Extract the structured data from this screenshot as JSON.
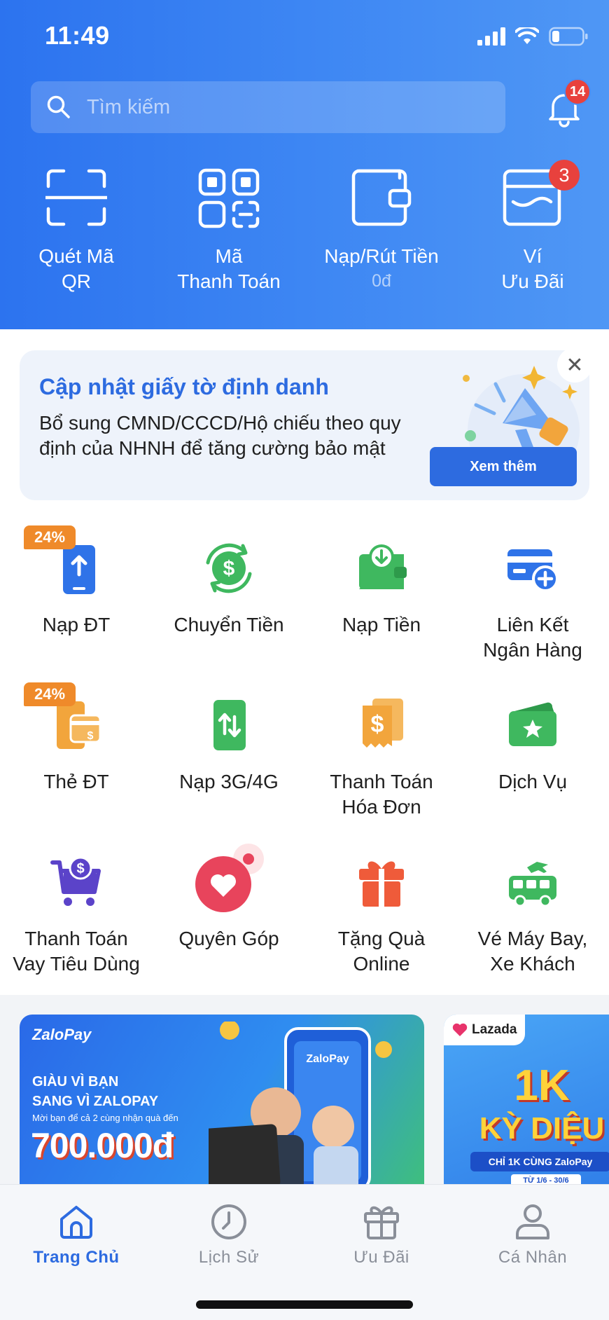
{
  "status_bar": {
    "time": "11:49"
  },
  "search": {
    "placeholder": "Tìm kiếm"
  },
  "notifications": {
    "badge": "14"
  },
  "quick_actions": [
    {
      "label_line1": "Quét Mã",
      "label_line2": "QR",
      "icon": "qr-scan-icon"
    },
    {
      "label_line1": "Mã",
      "label_line2": "Thanh Toán",
      "icon": "payment-code-icon"
    },
    {
      "label_line1": "Nạp/Rút Tiền",
      "sub": "0đ",
      "icon": "wallet-icon"
    },
    {
      "label_line1": "Ví",
      "label_line2": "Ưu Đãi",
      "badge": "3",
      "icon": "voucher-wallet-icon"
    }
  ],
  "promo": {
    "title": "Cập nhật giấy tờ định danh",
    "text": "Bổ sung CMND/CCCD/Hộ chiếu theo quy định của NHNH để tăng cường bảo mật",
    "button": "Xem thêm",
    "close": "✕"
  },
  "services": [
    {
      "label_line1": "Nạp ĐT",
      "badge": "24%",
      "icon": "phone-topup-icon",
      "color": "#2f73e8"
    },
    {
      "label_line1": "Chuyển Tiền",
      "icon": "money-transfer-icon",
      "color": "#3fb85f"
    },
    {
      "label_line1": "Nạp Tiền",
      "icon": "deposit-icon",
      "color": "#3fb85f"
    },
    {
      "label_line1": "Liên Kết",
      "label_line2": "Ngân Hàng",
      "icon": "bank-link-icon",
      "color": "#2f73e8"
    },
    {
      "label_line1": "Thẻ ĐT",
      "badge": "24%",
      "icon": "phone-card-icon",
      "color": "#f2a53c"
    },
    {
      "label_line1": "Nạp 3G/4G",
      "icon": "mobile-data-icon",
      "color": "#3fb85f"
    },
    {
      "label_line1": "Thanh Toán",
      "label_line2": "Hóa Đơn",
      "icon": "bill-payment-icon",
      "color": "#f2a53c"
    },
    {
      "label_line1": "Dịch Vụ",
      "icon": "services-icon",
      "color": "#3fb85f"
    },
    {
      "label_line1": "Thanh Toán",
      "label_line2": "Vay Tiêu Dùng",
      "icon": "loan-cart-icon",
      "color": "#5b43c9"
    },
    {
      "label_line1": "Quyên Góp",
      "icon": "donation-heart-icon",
      "color": "#e8445c"
    },
    {
      "label_line1": "Tặng Quà",
      "label_line2": "Online",
      "icon": "gift-icon",
      "color": "#ef5b3a"
    },
    {
      "label_line1": "Vé Máy Bay,",
      "label_line2": "Xe Khách",
      "icon": "bus-plane-icon",
      "color": "#3fb85f"
    }
  ],
  "banners": {
    "zalopay": {
      "logo": "ZaloPay",
      "line1": "GIÀU VÌ BẠN",
      "line2": "SANG VÌ ZALOPAY",
      "line3": "Mời bạn để cả 2 cùng nhận quà đến",
      "amount": "700.000đ"
    },
    "lazada": {
      "tag": "Lazada",
      "big": "1K",
      "title": "KỲ DIỆU",
      "sub": "CHỈ 1K CÙNG ZaloPay",
      "date": "TỪ 1/6 - 30/6"
    }
  },
  "bottom_nav": [
    {
      "label": "Trang Chủ",
      "icon": "home-icon",
      "active": true
    },
    {
      "label": "Lịch Sử",
      "icon": "history-clock-icon"
    },
    {
      "label": "Ưu Đãi",
      "icon": "gift-offer-icon"
    },
    {
      "label": "Cá Nhân",
      "icon": "user-profile-icon"
    }
  ],
  "colors": {
    "primary": "#2d6be0",
    "header_start": "#2c73ef",
    "header_end": "#4f97f5",
    "badge_red": "#e8413d",
    "badge_orange": "#ef8a2a"
  }
}
